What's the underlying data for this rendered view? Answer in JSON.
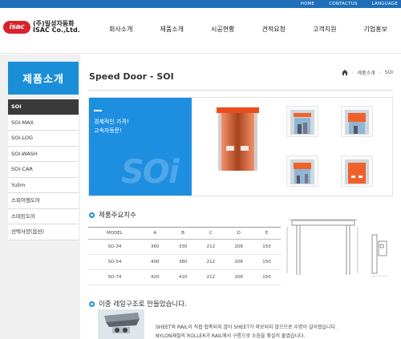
{
  "util_links": [
    "HOME",
    "CONTACTUS",
    "LANGUAGE"
  ],
  "logo": {
    "mark": "isac",
    "name_ko": "(주)일성자동화",
    "name_en": "ISAC Co.,Ltd."
  },
  "gnb": [
    "회사소개",
    "제품소개",
    "시공현황",
    "견적요청",
    "고객지원",
    "기업홍보"
  ],
  "sidebar": {
    "title": "제품소개",
    "items": [
      {
        "label": "SOI",
        "active": true
      },
      {
        "label": "SOI-MAX"
      },
      {
        "label": "SOI-LOG"
      },
      {
        "label": "SOI-WASH"
      },
      {
        "label": "SOI-CAR"
      },
      {
        "label": "Yulim"
      },
      {
        "label": "스피어엠도어"
      },
      {
        "label": "스테킹도어"
      },
      {
        "label": "선택사양(옵션)"
      }
    ]
  },
  "page": {
    "title": "Speed Door - SOI"
  },
  "breadcrumb": [
    "제품소개",
    "SOI"
  ],
  "hero": {
    "line1": "경제적인 가격!",
    "line2": "고속자동문!",
    "watermark": "SOi"
  },
  "spec_section": {
    "heading": "제품주요치수",
    "columns": [
      "MODEL",
      "A",
      "B",
      "C",
      "D",
      "E"
    ],
    "rows": [
      [
        "SO-34",
        "360",
        "330",
        "212",
        "206",
        "150"
      ],
      [
        "SO-54",
        "400",
        "380",
        "212",
        "206",
        "150"
      ],
      [
        "SO-74",
        "420",
        "410",
        "212",
        "206",
        "150"
      ]
    ]
  },
  "section2": {
    "heading": "이중 레일구조로 만들었습니다.",
    "line1": "SHEET와 RAIL이 직접 접촉되지 않아 SHEET가 마모되지 않으므로 수명이 길어졌습니다.",
    "line2": "NYLON재질의 ROLLER가 RAIL에서 구름으로 소음을 확실히 줄였습니다."
  },
  "colors": {
    "brand_blue": "#1a8fd8",
    "door_orange": "#f0612a",
    "logo_red": "#d9222a"
  }
}
